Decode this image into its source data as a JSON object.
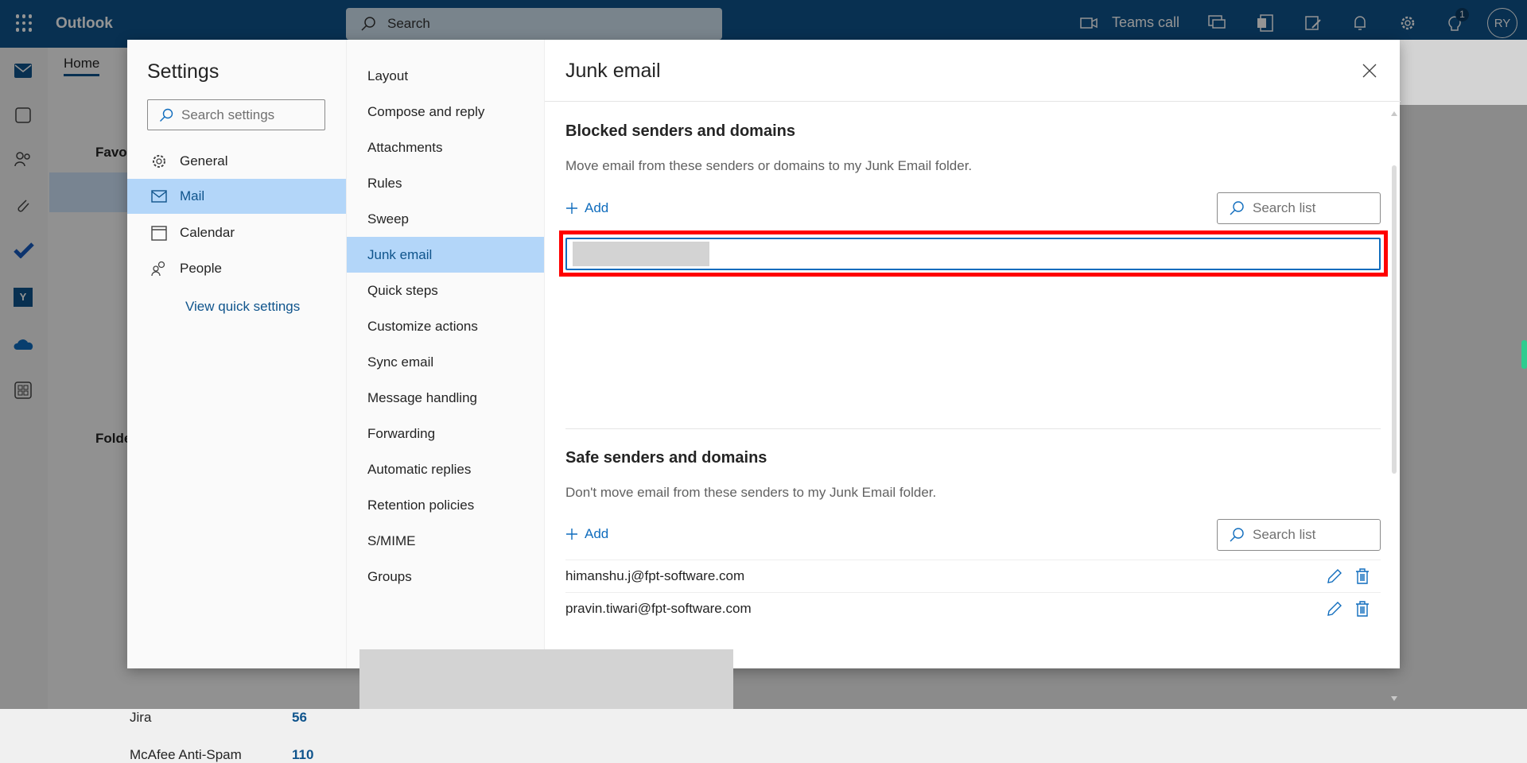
{
  "topbar": {
    "app_name": "Outlook",
    "search_placeholder": "Search",
    "teams_call": "Teams call",
    "tips_badge": "1",
    "avatar_initials": "RY"
  },
  "background": {
    "tab_home": "Home",
    "favorites": "Favorites",
    "folders": "Folders",
    "folder_jira": "Jira",
    "folder_jira_count": "56",
    "folder_mcafee": "McAfee Anti-Spam",
    "folder_mcafee_count": "110"
  },
  "settings": {
    "title": "Settings",
    "search_placeholder": "Search settings",
    "categories": [
      {
        "label": "General",
        "icon": "gear"
      },
      {
        "label": "Mail",
        "icon": "mail",
        "selected": true
      },
      {
        "label": "Calendar",
        "icon": "calendar"
      },
      {
        "label": "People",
        "icon": "people"
      }
    ],
    "view_quick_settings": "View quick settings",
    "mail_sections": [
      "Layout",
      "Compose and reply",
      "Attachments",
      "Rules",
      "Sweep",
      "Junk email",
      "Quick steps",
      "Customize actions",
      "Sync email",
      "Message handling",
      "Forwarding",
      "Automatic replies",
      "Retention policies",
      "S/MIME",
      "Groups"
    ],
    "selected_section": "Junk email"
  },
  "junk": {
    "title": "Junk email",
    "blocked": {
      "title": "Blocked senders and domains",
      "description": "Move email from these senders or domains to my Junk Email folder.",
      "add_label": "Add",
      "search_placeholder": "Search list",
      "input_value": ""
    },
    "safe": {
      "title": "Safe senders and domains",
      "description": "Don't move email from these senders to my Junk Email folder.",
      "add_label": "Add",
      "search_placeholder": "Search list",
      "entries": [
        "himanshu.j@fpt-software.com",
        "pravin.tiwari@fpt-software.com"
      ]
    }
  },
  "colors": {
    "brand": "#0f548c",
    "accent": "#0f6cbd",
    "selected": "#b3d6f9",
    "highlight_box": "#ff0000"
  }
}
